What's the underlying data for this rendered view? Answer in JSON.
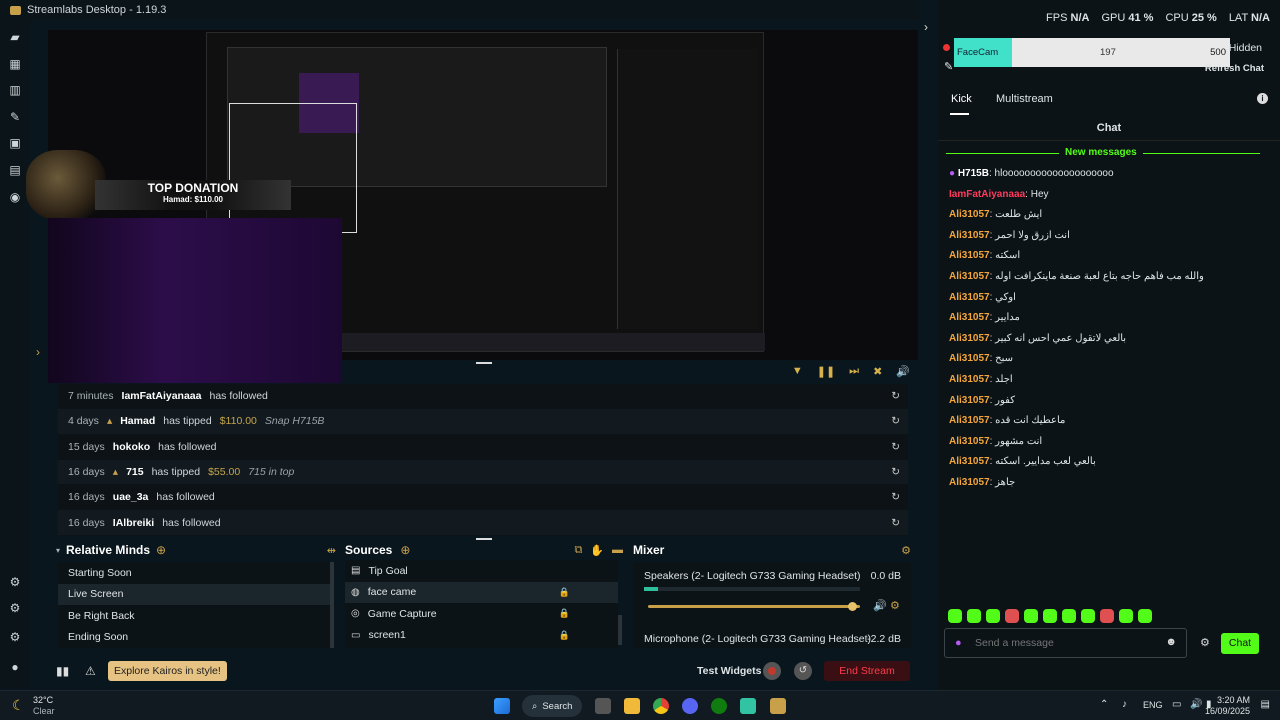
{
  "window": {
    "title": "Streamlabs Desktop - 1.19.3"
  },
  "stats": {
    "fps_label": "FPS",
    "fps_value": "N/A",
    "gpu_label": "GPU",
    "gpu_value": "41 %",
    "cpu_label": "CPU",
    "cpu_value": "25 %",
    "lat_label": "LAT",
    "lat_value": "N/A"
  },
  "facecam": {
    "name": "FaceCam",
    "value": "197",
    "max": "500",
    "fill": 0.394,
    "hidden_label": "Hidden",
    "refresh_label": "Refresh Chat"
  },
  "chat_tabs": [
    {
      "label": "Kick"
    },
    {
      "label": "Multistream"
    }
  ],
  "chat": {
    "header": "Chat",
    "new_messages_label": "New messages",
    "messages": [
      {
        "user": "H715B",
        "text": "hloooooooooooooooooooo",
        "color": "#ffffff"
      },
      {
        "user": "IamFatAiyanaaa",
        "text": "Hey",
        "color": "#ff3b5c"
      },
      {
        "user": "Ali31057",
        "text": "ايش طلعت",
        "color": "#f4a63b"
      },
      {
        "user": "Ali31057",
        "text": "انت ازرق ولا احمر",
        "color": "#f4a63b"
      },
      {
        "user": "Ali31057",
        "text": "اسكته",
        "color": "#f4a63b"
      },
      {
        "user": "Ali31057",
        "text": "والله مب فاهم حاجه بتاع لعبة صنعة ماينكرافت اوله",
        "color": "#f4a63b"
      },
      {
        "user": "Ali31057",
        "text": "اوكي",
        "color": "#f4a63b"
      },
      {
        "user": "Ali31057",
        "text": "مدايير",
        "color": "#f4a63b"
      },
      {
        "user": "Ali31057",
        "text": "بالعي لاتقول عمي احس انه كبير",
        "color": "#f4a63b"
      },
      {
        "user": "Ali31057",
        "text": "سبح",
        "color": "#f4a63b"
      },
      {
        "user": "Ali31057",
        "text": "اجلد",
        "color": "#f4a63b"
      },
      {
        "user": "Ali31057",
        "text": "كفور",
        "color": "#f4a63b"
      },
      {
        "user": "Ali31057",
        "text": "ماعطيك انت قده",
        "color": "#f4a63b"
      },
      {
        "user": "Ali31057",
        "text": "انت مشهور",
        "color": "#f4a63b"
      },
      {
        "user": "Ali31057",
        "text": "بالعي لعب مدايير. اسكته",
        "color": "#f4a63b"
      },
      {
        "user": "Ali31057",
        "text": "جاهز",
        "color": "#f4a63b"
      }
    ],
    "input_placeholder": "Send a message",
    "send_label": "Chat"
  },
  "donation": {
    "title": "TOP DONATION",
    "subtitle": "Hamad: $110.00"
  },
  "events": [
    {
      "time": "7 minutes",
      "name": "IamFatAiyanaaa",
      "action": "has followed",
      "amount": "",
      "message": ""
    },
    {
      "time": "4 days",
      "name": "Hamad",
      "action": "has tipped",
      "amount": "$110.00",
      "message": "Snap H715B"
    },
    {
      "time": "15 days",
      "name": "hokoko",
      "action": "has followed",
      "amount": "",
      "message": ""
    },
    {
      "time": "16 days",
      "name": "715",
      "action": "has tipped",
      "amount": "$55.00",
      "message": "715 in top"
    },
    {
      "time": "16 days",
      "name": "uae_3a",
      "action": "has followed",
      "amount": "",
      "message": ""
    },
    {
      "time": "16 days",
      "name": "IAlbreiki",
      "action": "has followed",
      "amount": "",
      "message": ""
    }
  ],
  "scenes": {
    "title": "Relative Minds",
    "items": [
      {
        "label": "Starting Soon"
      },
      {
        "label": "Live Screen"
      },
      {
        "label": "Be Right Back"
      },
      {
        "label": "Ending Soon"
      }
    ]
  },
  "sources": {
    "title": "Sources",
    "items": [
      {
        "label": "Tip Goal"
      },
      {
        "label": "face came"
      },
      {
        "label": "Game Capture"
      },
      {
        "label": "screen1"
      }
    ]
  },
  "mixer": {
    "title": "Mixer",
    "channels": [
      {
        "name": "Speakers (2- Logitech G733 Gaming Headset)",
        "db": "0.0 dB",
        "volume": 0.98
      },
      {
        "name": "Microphone (2- Logitech G733 Gaming Headset)",
        "db": "-2.2 dB"
      }
    ]
  },
  "bottom": {
    "promo_label": "Explore Kairos in style!",
    "test_widgets_label": "Test Widgets",
    "end_stream_label": "End Stream"
  },
  "taskbar": {
    "temperature": "32°C",
    "weather": "Clear",
    "search_label": "Search",
    "language": "ENG",
    "time": "3:20 AM",
    "date": "16/09/2025"
  }
}
